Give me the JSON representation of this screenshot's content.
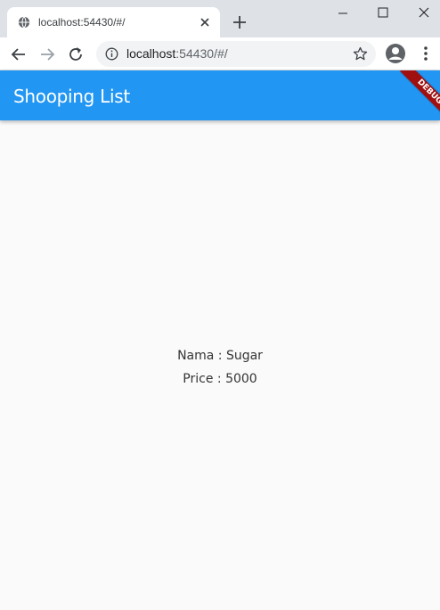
{
  "browser": {
    "tab_title": "localhost:54430/#/",
    "url_host": "localhost",
    "url_rest": ":54430/#/"
  },
  "app": {
    "title": "Shooping List",
    "debug_banner": "DEBUG"
  },
  "item": {
    "name_line": "Nama : Sugar",
    "price_line": "Price : 5000"
  },
  "colors": {
    "appbar": "#2196f3",
    "debug_banner": "#a01010",
    "background": "#fafafa"
  }
}
